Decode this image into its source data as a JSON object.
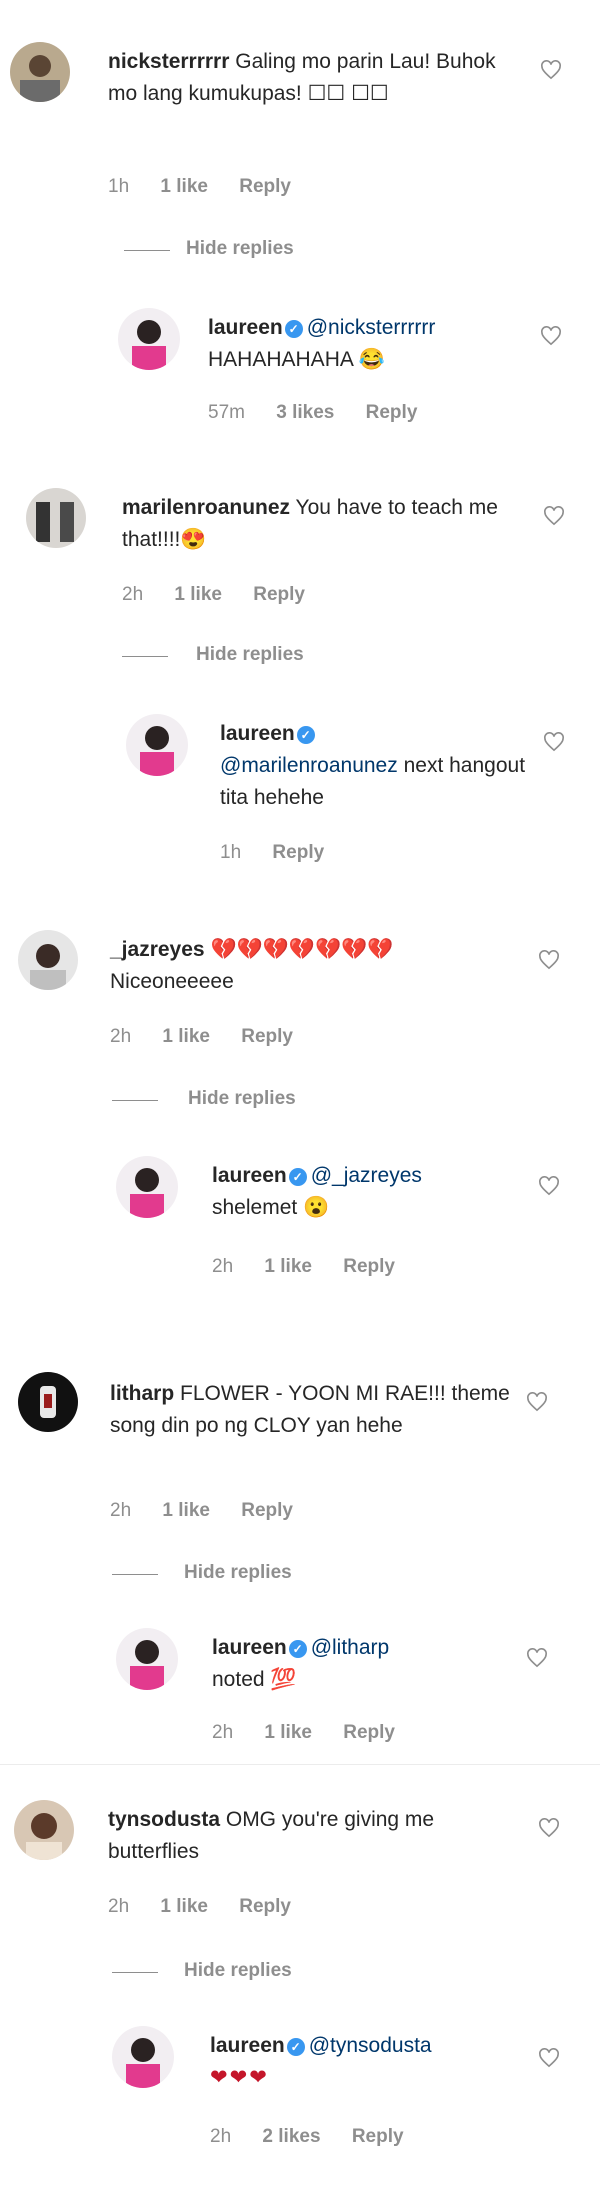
{
  "threads": [
    {
      "comment": {
        "user": "nicksterrrrrr",
        "text": "Galing mo parin Lau! Buhok mo lang kumukupas! ☐☐ ☐☐",
        "time": "1h",
        "likes": "1 like",
        "reply": "Reply"
      },
      "hide": "Hide replies",
      "reply": {
        "user": "laureen",
        "mention": "@nicksterrrrrr",
        "text": "HAHAHAHAHA 😂",
        "time": "57m",
        "likes": "3 likes",
        "reply": "Reply"
      }
    },
    {
      "comment": {
        "user": "marilenroanunez",
        "text": "You have to teach me that!!!!😍",
        "time": "2h",
        "likes": "1 like",
        "reply": "Reply"
      },
      "hide": "Hide replies",
      "reply": {
        "user": "laureen",
        "mention": "@marilenroanunez",
        "text": "next hangout tita hehehe",
        "time": "1h",
        "likes": "",
        "reply": "Reply"
      }
    },
    {
      "comment": {
        "user": "_jazreyes",
        "text": "💔💔💔💔💔💔💔 Niceoneeeee",
        "time": "2h",
        "likes": "1 like",
        "reply": "Reply"
      },
      "hide": "Hide replies",
      "reply": {
        "user": "laureen",
        "mention": "@_jazreyes",
        "text": "shelemet 😮",
        "time": "2h",
        "likes": "1 like",
        "reply": "Reply"
      }
    },
    {
      "comment": {
        "user": "litharp",
        "text": "FLOWER - YOON MI RAE!!! theme song din po ng CLOY yan hehe",
        "time": "2h",
        "likes": "1 like",
        "reply": "Reply"
      },
      "hide": "Hide replies",
      "reply": {
        "user": "laureen",
        "mention": "@litharp",
        "text": "noted 💯",
        "time": "2h",
        "likes": "1 like",
        "reply": "Reply"
      }
    },
    {
      "comment": {
        "user": "tynsodusta",
        "text": "OMG you're giving me butterflies",
        "time": "2h",
        "likes": "1 like",
        "reply": "Reply"
      },
      "hide": "Hide replies",
      "reply": {
        "user": "laureen",
        "mention": "@tynsodusta",
        "text": "❤❤❤",
        "time": "2h",
        "likes": "2 likes",
        "reply": "Reply"
      }
    }
  ],
  "colors": {
    "username": "#262626",
    "mention": "#00376b",
    "meta": "#8e8e8e",
    "verified": "#3897f0"
  },
  "icons": {
    "like": "heart-outline-icon",
    "verified": "verified-badge-icon"
  }
}
